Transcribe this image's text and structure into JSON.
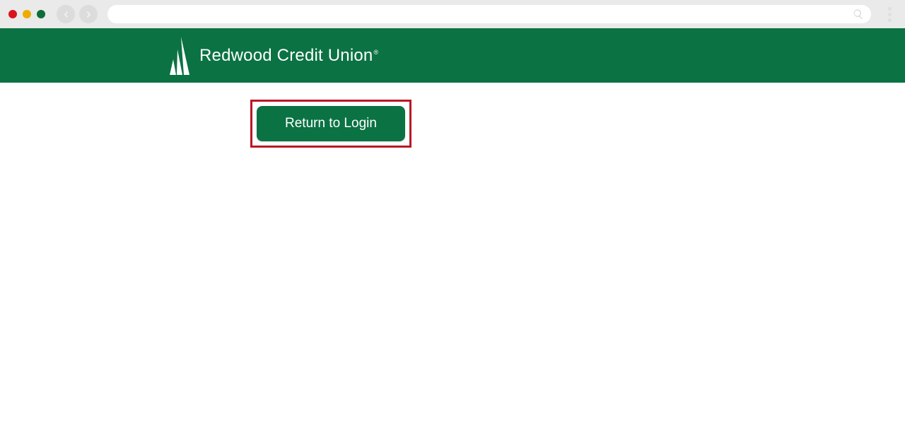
{
  "browser": {
    "address_value": ""
  },
  "banner": {
    "brand_name": "Redwood Credit Union"
  },
  "content": {
    "return_button_label": "Return to Login"
  }
}
